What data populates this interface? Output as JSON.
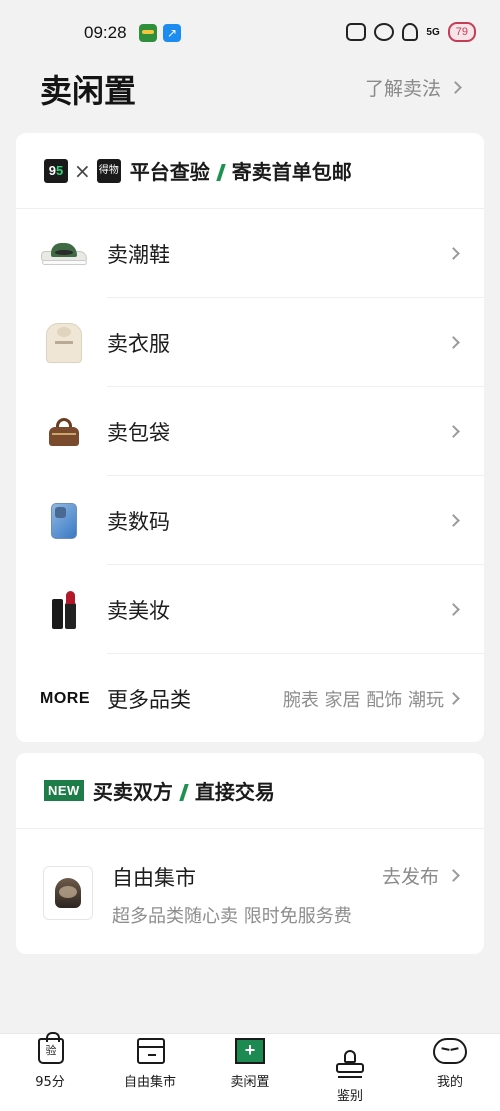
{
  "status_bar": {
    "time": "09:28",
    "app2_glyph": "↗",
    "signal": "5G",
    "battery": "79"
  },
  "header": {
    "title": "卖闲置",
    "learn_link": "了解卖法"
  },
  "platform_card": {
    "logo_95": [
      "9",
      "5"
    ],
    "times": "×",
    "logo_dewu": "得物",
    "head_left": "平台查验",
    "head_right": "寄卖首单包邮",
    "categories": [
      {
        "label": "卖潮鞋",
        "icon": "sneaker-icon"
      },
      {
        "label": "卖衣服",
        "icon": "hoodie-icon"
      },
      {
        "label": "卖包袋",
        "icon": "handbag-icon"
      },
      {
        "label": "卖数码",
        "icon": "phone-icon"
      },
      {
        "label": "卖美妆",
        "icon": "lipstick-icon"
      }
    ],
    "more": {
      "logo": "MORE",
      "label": "更多品类",
      "tags": "腕表 家居 配饰 潮玩"
    }
  },
  "direct_card": {
    "badge": "NEW",
    "head_left": "买卖双方",
    "head_right": "直接交易",
    "market": {
      "title": "自由集市",
      "subtitle": "超多品类随心卖 限时免服务费",
      "action": "去发布"
    }
  },
  "bottom_nav": {
    "items": [
      {
        "label": "95分",
        "icon": "shopping-bag-icon",
        "glyph": "验"
      },
      {
        "label": "自由集市",
        "icon": "market-stall-icon"
      },
      {
        "label": "卖闲置",
        "icon": "sell-plus-icon",
        "glyph": "+",
        "active": true
      },
      {
        "label": "鉴别",
        "icon": "stamp-icon"
      },
      {
        "label": "我的",
        "icon": "mascot-face-icon"
      }
    ]
  },
  "colors": {
    "accent": "#1d8a52",
    "badge_green": "#1d7d48",
    "battery": "#c43d55"
  }
}
